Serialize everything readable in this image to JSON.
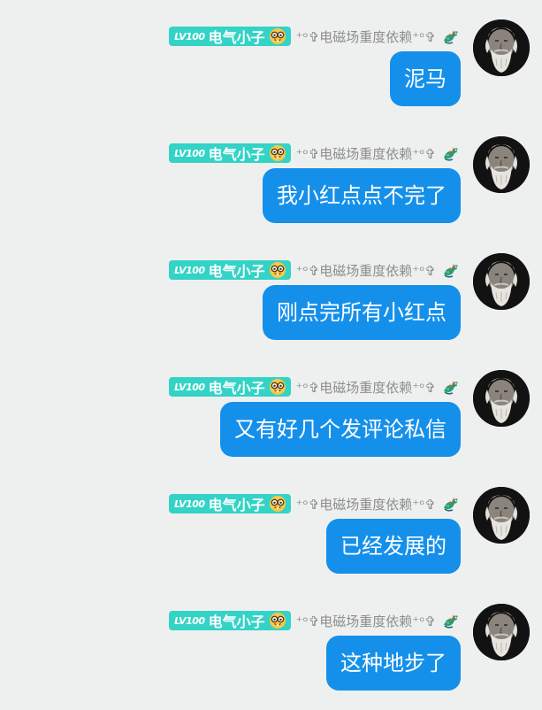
{
  "sender": {
    "level": "LV100",
    "nickname": "电气小子",
    "nickname_emoji": "nerd-face-icon",
    "fan_tag": "⁺ᵒ✞电磁场重度依赖⁺ᵒ✞",
    "tag_icon": "dragon-icon",
    "avatar": "avatar-bearded-man",
    "badge_color": "#33d3c6"
  },
  "bubble_color": "#1590ea",
  "messages": [
    {
      "text": "泥马"
    },
    {
      "text": "我小红点点不完了"
    },
    {
      "text": "刚点完所有小红点"
    },
    {
      "text": "又有好几个发评论私信"
    },
    {
      "text": "已经发展的"
    },
    {
      "text": "这种地步了"
    }
  ]
}
